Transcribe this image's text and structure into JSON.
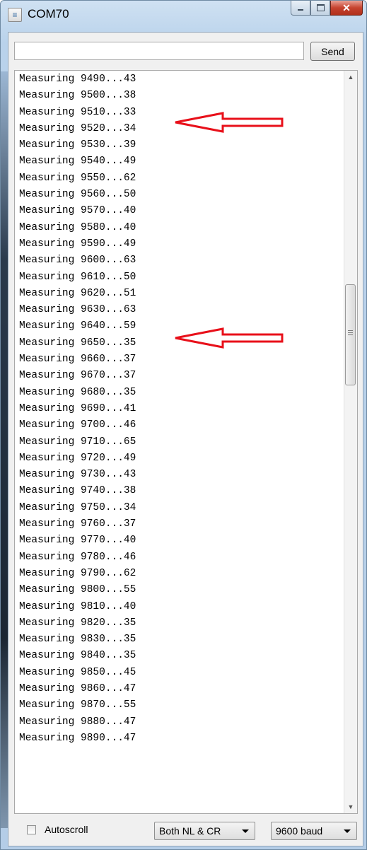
{
  "window": {
    "title": "COM70"
  },
  "send": {
    "value": "",
    "button_label": "Send"
  },
  "output_lines": [
    "Measuring 9490...43",
    "Measuring 9500...38",
    "Measuring 9510...33",
    "Measuring 9520...34",
    "Measuring 9530...39",
    "Measuring 9540...49",
    "Measuring 9550...62",
    "Measuring 9560...50",
    "Measuring 9570...40",
    "Measuring 9580...40",
    "Measuring 9590...49",
    "Measuring 9600...63",
    "Measuring 9610...50",
    "Measuring 9620...51",
    "Measuring 9630...63",
    "Measuring 9640...59",
    "Measuring 9650...35",
    "Measuring 9660...37",
    "Measuring 9670...37",
    "Measuring 9680...35",
    "Measuring 9690...41",
    "Measuring 9700...46",
    "Measuring 9710...65",
    "Measuring 9720...49",
    "Measuring 9730...43",
    "Measuring 9740...38",
    "Measuring 9750...34",
    "Measuring 9760...37",
    "Measuring 9770...40",
    "Measuring 9780...46",
    "Measuring 9790...62",
    "Measuring 9800...55",
    "Measuring 9810...40",
    "Measuring 9820...35",
    "Measuring 9830...35",
    "Measuring 9840...35",
    "Measuring 9850...45",
    "Measuring 9860...47",
    "Measuring 9870...55",
    "Measuring 9880...47",
    "Measuring 9890...47"
  ],
  "annotations": {
    "arrow_color": "#e8101a",
    "highlighted_lines": [
      2,
      14
    ]
  },
  "footer": {
    "autoscroll_label": "Autoscroll",
    "autoscroll_checked": false,
    "line_ending": "Both NL & CR",
    "baud_rate": "9600 baud"
  },
  "icons": {
    "app": "arduino-app-icon",
    "minimize": "minimize-icon",
    "maximize": "maximize-icon",
    "close": "close-icon"
  }
}
